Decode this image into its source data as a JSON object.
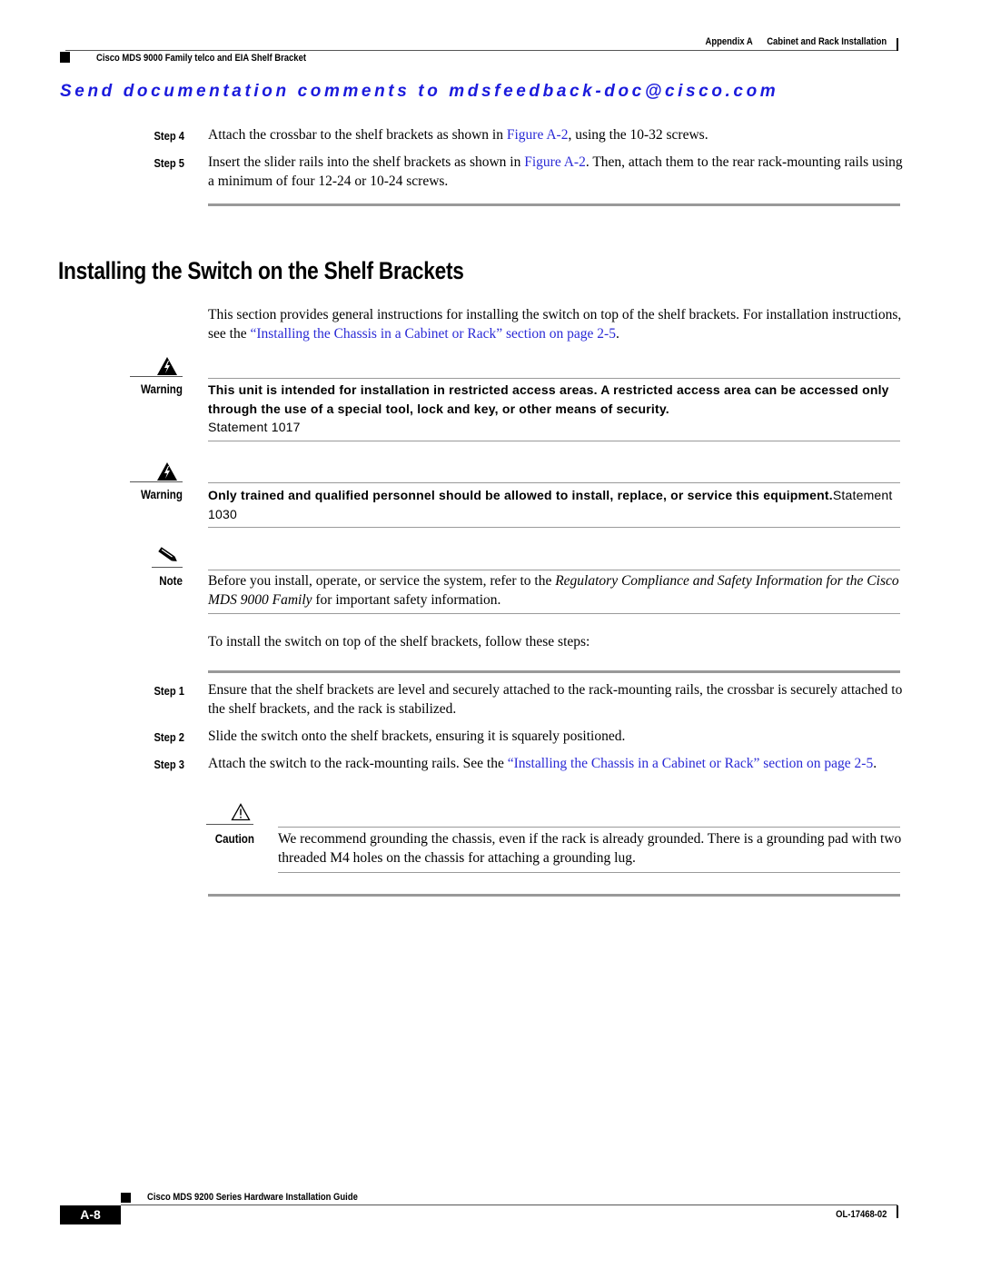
{
  "header": {
    "appendix": "Appendix A",
    "chapter": "Cabinet and Rack Installation",
    "section": "Cisco MDS 9000 Family telco and EIA Shelf Bracket"
  },
  "feedback_banner": "Send documentation comments to mdsfeedback-doc@cisco.com",
  "colors": {
    "link": "#2a2ad6",
    "feedback": "#1a1adc"
  },
  "top_steps": [
    {
      "label": "Step 4",
      "before": "Attach the crossbar to the shelf brackets as shown in ",
      "link": "Figure A-2",
      "after": ", using the 10-32 screws."
    },
    {
      "label": "Step 5",
      "before": "Insert the slider rails into the shelf brackets as shown in ",
      "link": "Figure A-2",
      "after": ". Then, attach them to the rear rack-mounting rails using a minimum of four 12-24 or 10-24 screws."
    }
  ],
  "section": {
    "title": "Installing the Switch on the Shelf Brackets",
    "intro_before": "This section provides general instructions for installing the switch on top of the shelf brackets. For installation instructions, see the ",
    "intro_link": "“Installing the Chassis in a Cabinet or Rack” section on page 2-5",
    "intro_after": "."
  },
  "warnings": [
    {
      "label": "Warning",
      "icon": "warning-lightning-icon",
      "text": "This unit is intended for installation in restricted access areas. A restricted access area can be accessed only through the use of a special tool, lock and key, or other means of security.",
      "statement": "Statement 1017"
    },
    {
      "label": "Warning",
      "icon": "warning-lightning-icon",
      "text": "Only trained and qualified personnel should be allowed to install, replace, or service this equipment.",
      "statement": "Statement 1030"
    }
  ],
  "note": {
    "label": "Note",
    "icon": "pencil-icon",
    "before": "Before you install, operate, or service the system, refer to the ",
    "italic": "Regulatory Compliance and Safety Information for the Cisco MDS 9000 Family",
    "after": " for important safety information."
  },
  "procedure_intro": "To install the switch on top of the shelf brackets, follow these steps:",
  "steps": [
    {
      "label": "Step 1",
      "text": "Ensure that the shelf brackets are level and securely attached to the rack-mounting rails, the crossbar is securely attached to the shelf brackets, and the rack is stabilized."
    },
    {
      "label": "Step 2",
      "text": "Slide the switch onto the shelf brackets, ensuring it is squarely positioned."
    },
    {
      "label": "Step 3",
      "before": "Attach the switch to the rack-mounting rails. See the ",
      "link": "“Installing the Chassis in a Cabinet or Rack” section on page 2-5",
      "after": "."
    }
  ],
  "caution": {
    "label": "Caution",
    "icon": "caution-triangle-icon",
    "text": "We recommend grounding the chassis, even if the rack is already grounded. There is a grounding pad with two threaded M4 holes on the chassis for attaching a grounding lug."
  },
  "footer": {
    "guide_title": "Cisco MDS 9200 Series Hardware Installation Guide",
    "page_number": "A-8",
    "doc_id": "OL-17468-02"
  }
}
